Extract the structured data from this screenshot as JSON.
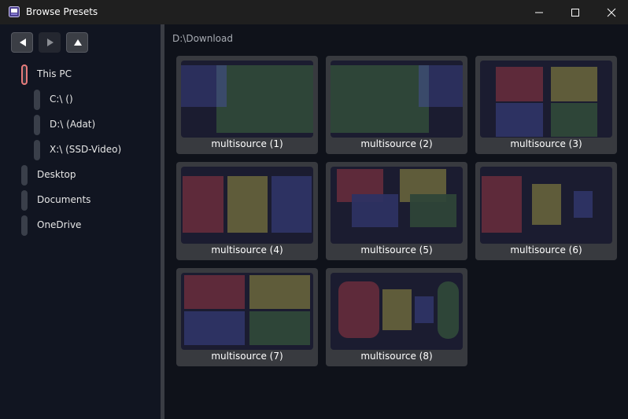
{
  "window": {
    "title": "Browse Presets"
  },
  "nav": {
    "back": "back-arrow",
    "forward": "forward-arrow",
    "up": "up-arrow"
  },
  "tree": [
    {
      "label": "This PC",
      "level": 0,
      "active": true
    },
    {
      "label": "C:\\ ()",
      "level": 1
    },
    {
      "label": "D:\\ (Adat)",
      "level": 1
    },
    {
      "label": "X:\\ (SSD-Video)",
      "level": 1
    },
    {
      "label": "Desktop",
      "level": 0
    },
    {
      "label": "Documents",
      "level": 0
    },
    {
      "label": "OneDrive",
      "level": 0
    }
  ],
  "main": {
    "path": "D:\\Download",
    "presets": [
      {
        "label": "multisource (1)"
      },
      {
        "label": "multisource (2)"
      },
      {
        "label": "multisource (3)"
      },
      {
        "label": "multisource (4)"
      },
      {
        "label": "multisource (5)"
      },
      {
        "label": "multisource (6)"
      },
      {
        "label": "multisource (7)"
      },
      {
        "label": "multisource (8)"
      }
    ]
  },
  "colors": {
    "red": "#5e2a3a",
    "yellow": "#5f5c3a",
    "blue": "#2d3262",
    "green": "#2e4538",
    "thumb_bg": "#1b1c30",
    "active_indicator": "#e77b7b"
  }
}
